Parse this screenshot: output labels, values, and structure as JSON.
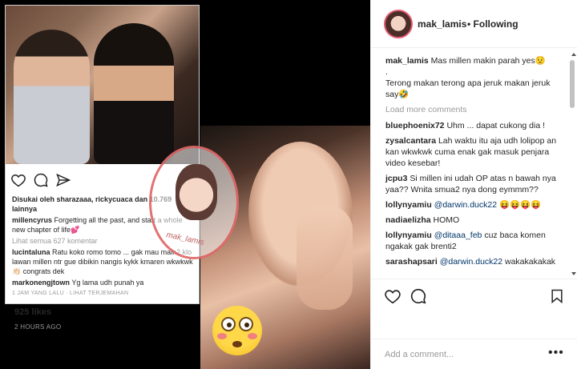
{
  "post": {
    "username": "mak_lamis",
    "follow_status": "• Following"
  },
  "screenshot": {
    "liked_by": "Disukai oleh sharazaaa, rickycuaca dan 10.769 lainnya",
    "caption_user": "millencyrus",
    "caption_text": "Forgetting all the past, and start a whole new chapter of life💕",
    "view_all": "Lihat semua 627 komentar",
    "comments": [
      {
        "user": "lucintaluna",
        "text": "Ratu koko romo tomo ... gak mau main2 klo lawan millen ntr gue dibikin nangis kykk kmaren wkwkwk 👏🏻 congrats dek"
      },
      {
        "user": "markonengjtown",
        "text": "Yg lama udh punah ya"
      }
    ],
    "timestamp": "1 JAM YANG LALU · LIHAT TERJEMAHAN",
    "watermark": "mak_lamis"
  },
  "comments": [
    {
      "user": "mak_lamis",
      "text": "Mas millen makin parah yes😟\n.\nTerong makan terong apa jeruk makan jeruk say🤣"
    },
    {
      "user": "bluephoenix72",
      "text": "Uhm ... dapat cukong dia !"
    },
    {
      "user": "zysalcantara",
      "text": "Lah waktu itu aja udh lolipop an kan wkwkwk cuma enak gak masuk penjara video kesebar!"
    },
    {
      "user": "jcpu3",
      "text": "Si millen ini udah OP atas n bawah nya yaa?? Wnita smua2 nya dong eymmm??"
    },
    {
      "user": "lollynyamiu",
      "mention": "@darwin.duck22",
      "text": " 😝😝😝😝"
    },
    {
      "user": "nadiaelizha",
      "text": "HOMO"
    },
    {
      "user": "lollynyamiu",
      "mention": "@ditaaa_feb",
      "text": " cuz baca komen ngakak gak brenti2"
    },
    {
      "user": "sarashapsari",
      "mention": "@darwin.duck22",
      "text": " wakakakakak"
    }
  ],
  "load_more": "Load more comments",
  "likes": "925 likes",
  "time_ago": "2 HOURS AGO",
  "add_comment_placeholder": "Add a comment...",
  "more_options": "•••",
  "icons": [
    "heart-icon",
    "comment-icon",
    "bookmark-icon",
    "more-options-icon"
  ]
}
